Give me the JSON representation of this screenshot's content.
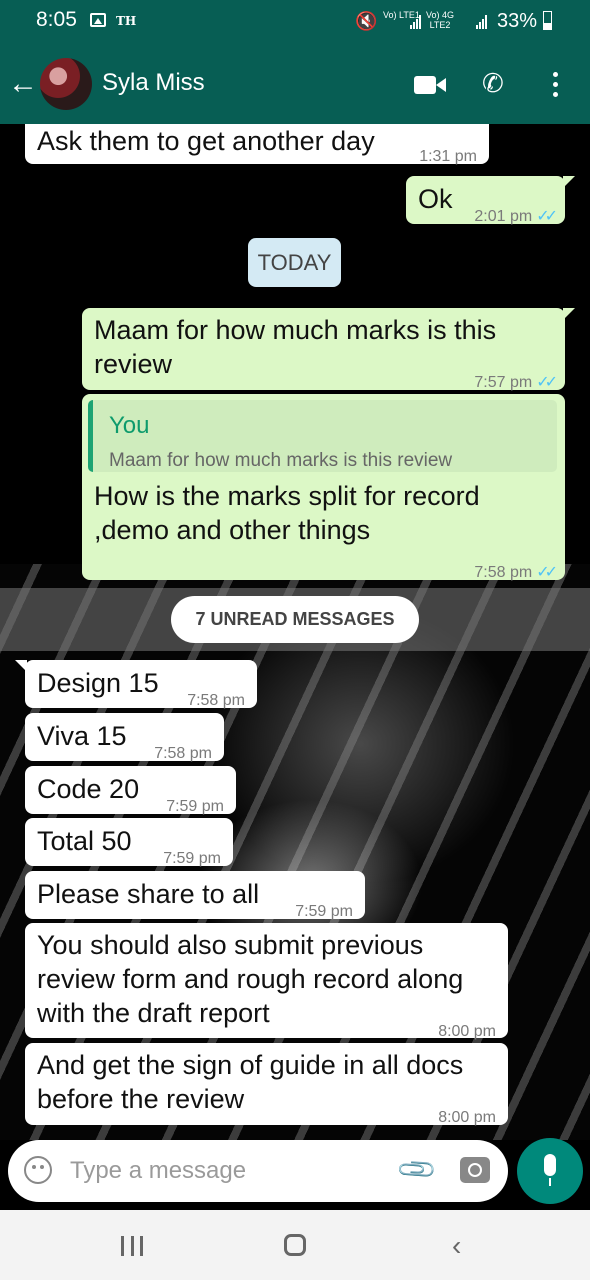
{
  "status_bar": {
    "time": "8:05",
    "carrier_tag": "TH",
    "sim1": "Vo) LTE1",
    "sim2": "Vo) 4G LTE2",
    "battery": "33%"
  },
  "header": {
    "contact_name": "Syla Miss"
  },
  "messages": [
    {
      "direction": "in",
      "text": "Ask them to get another day",
      "time": "1:31 pm"
    },
    {
      "direction": "out",
      "text": "Ok",
      "time": "2:01 pm",
      "status": "read"
    },
    {
      "direction": "out",
      "text": "Maam for how much marks is this review",
      "time": "7:57 pm",
      "status": "read"
    },
    {
      "direction": "out",
      "quote_author": "You",
      "quote_text": "Maam for how much marks is this review",
      "text": "How is the marks split for record ,demo and other things",
      "time": "7:58 pm",
      "status": "read"
    },
    {
      "direction": "in",
      "text": "Design 15",
      "time": "7:58 pm"
    },
    {
      "direction": "in",
      "text": "Viva 15",
      "time": "7:58 pm"
    },
    {
      "direction": "in",
      "text": "Code 20",
      "time": "7:59 pm"
    },
    {
      "direction": "in",
      "text": "Total 50",
      "time": "7:59 pm"
    },
    {
      "direction": "in",
      "text": "Please share to all",
      "time": "7:59 pm"
    },
    {
      "direction": "in",
      "text": "You should  also submit previous review form and rough record along with the draft report",
      "time": "8:00 pm"
    },
    {
      "direction": "in",
      "text": "And get the sign of guide in all docs before the review",
      "time": "8:00 pm"
    }
  ],
  "date_divider": "TODAY",
  "unread_banner": "7 UNREAD MESSAGES",
  "input": {
    "placeholder": "Type a message"
  },
  "colors": {
    "header": "#075e54",
    "outgoing_bubble": "#dcf8c6",
    "incoming_bubble": "#ffffff",
    "send_button": "#00897b",
    "read_ticks": "#4fc3f7"
  },
  "icons": [
    "back-arrow-icon",
    "video-call-icon",
    "voice-call-icon",
    "more-options-icon",
    "emoji-icon",
    "attach-icon",
    "camera-icon",
    "mic-icon"
  ]
}
